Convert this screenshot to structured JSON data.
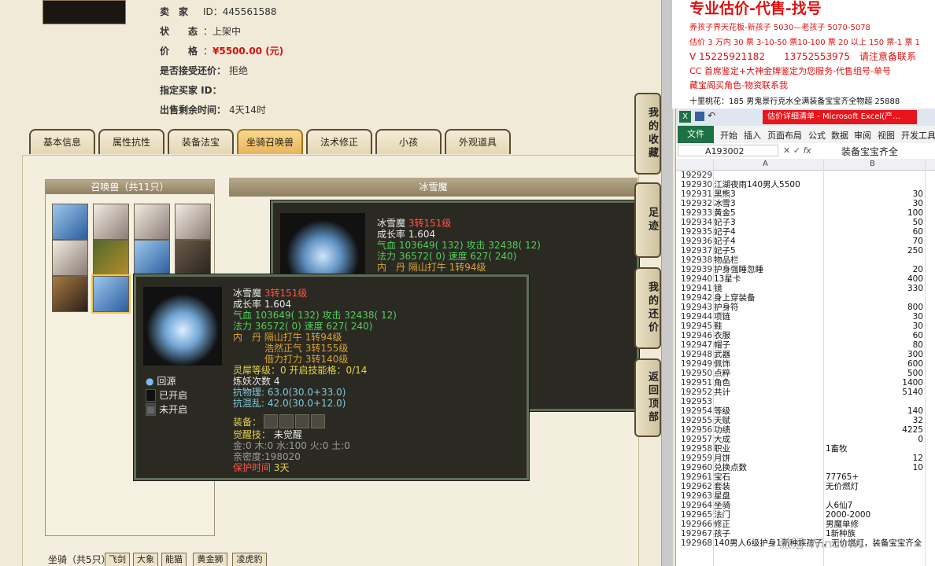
{
  "seller_info": {
    "seller_label": "卖　家",
    "seller_id": "ID：445561588",
    "status_label": "状　　态",
    "status_value": "上架中",
    "price_label": "价　　格",
    "price_value": "¥5500.00 (元)",
    "bargain_label": "是否接受还价：",
    "bargain_value": "拒绝",
    "buyer_label": "指定买家 ID：",
    "buyer_value": "",
    "remaining_label": "出售剩余时间：",
    "remaining_value": "4天14时"
  },
  "tabs": [
    "基本信息",
    "属性抗性",
    "装备法宝",
    "坐骑召唤兽",
    "法术修正",
    "小孩",
    "外观道具"
  ],
  "active_tab": 3,
  "summon": {
    "panel_title": "召唤兽（共11只）",
    "detail_title": "冰雪魔"
  },
  "tooltip_back": {
    "name": "冰雪魔",
    "level": "3转151级",
    "growth": "成长率 1.604",
    "hp": "气血 103649( 132) 攻击 32438( 12)",
    "mp": "法力 36572( 0) 速度 627( 240)",
    "dan": "内　丹 隔山打牛 1转94级",
    "dan2": "浩然正气 3转155级"
  },
  "tooltip_front": {
    "name": "冰雪魔",
    "level": "3转151级",
    "growth": "成长率 1.604",
    "hp": "气血 103649( 132) 攻击 32438( 12)",
    "mp": "法力 36572( 0) 速度 627( 240)",
    "dan1": "内　丹 隔山打牛 1转94级",
    "dan2": "浩然正气 3转155级",
    "dan3": "借力打力 3转140级",
    "lingxi": "灵犀等级：0 开启技能格：0/14",
    "lianyao": "炼妖次数 4",
    "resist1": "抗物理: 63.0(30.0+33.0)",
    "resist2": "抗混乱: 42.0(30.0+12.0)",
    "equip": "装备：",
    "awaken_label": "觉醒技：",
    "awaken_value": "未觉醒",
    "elements": "金:0 木:0 水:100 火:0 土:0",
    "intimacy": "亲密度:198020",
    "protect_label": "保护时间",
    "protect_value": "3天",
    "legend_return": "回源",
    "legend_open": "已开启",
    "legend_closed": "未开启"
  },
  "side_buttons": [
    "我的收藏",
    "足迹",
    "我的还价",
    "返回顶部"
  ],
  "mounts": {
    "label": "坐骑（共5只）",
    "items": [
      "飞剑",
      "大象",
      "能猫",
      "黄金狮",
      "凌虎豹"
    ]
  },
  "promo": {
    "title": "专业估价-代售-找号",
    "line1": "养孩子界天花板-新孩子 5030—老孩子 5070-5078",
    "line2": "估价 3 万内 30 票 3-10-50 票10-100 票 20 以上 150 票-1 票 1",
    "line3": "V 15225921182　　13752553975　请注意备联系",
    "line4": "CC 首席鉴定+大神金牌鉴定为您服务-代售组号-单号",
    "line5": "藏宝阁买角色-物资联系我",
    "line6": "十里桃花：185 男鬼景行克水全满装备宝宝齐全物超 25888"
  },
  "excel": {
    "title": "估价详细清单 - Microsoft Excel(产…",
    "ribbon": [
      "文件",
      "开始",
      "插入",
      "页面布局",
      "公式",
      "数据",
      "审阅",
      "视图",
      "开发工具"
    ],
    "cell_ref": "A193002",
    "formula": "装备宝宝齐全",
    "col_a": "A",
    "col_b": "B",
    "rows": [
      [
        "192929",
        "",
        ""
      ],
      [
        "192930",
        "江湖夜雨140男人5500",
        ""
      ],
      [
        "192931",
        "黑熊3",
        "30"
      ],
      [
        "192932",
        "冰雪3",
        "30"
      ],
      [
        "192933",
        "黄金5",
        "100"
      ],
      [
        "192934",
        "妃子3",
        "50"
      ],
      [
        "192935",
        "妃子4",
        "60"
      ],
      [
        "192936",
        "妃子4",
        "70"
      ],
      [
        "192937",
        "妃子5",
        "250"
      ],
      [
        "192938",
        "物品栏",
        ""
      ],
      [
        "192939",
        "护身强睡忽睡",
        "20"
      ],
      [
        "192940",
        "13星卡",
        "400"
      ],
      [
        "192941",
        "镜",
        "330"
      ],
      [
        "192942",
        "身上穿装备",
        ""
      ],
      [
        "192943",
        "护身符",
        "800"
      ],
      [
        "192944",
        "项链",
        "30"
      ],
      [
        "192945",
        "鞋",
        "30"
      ],
      [
        "192946",
        "衣服",
        "60"
      ],
      [
        "192947",
        "帽子",
        "80"
      ],
      [
        "192948",
        "武器",
        "300"
      ],
      [
        "192949",
        "佩饰",
        "600"
      ],
      [
        "192950",
        "点粹",
        "500"
      ],
      [
        "192951",
        "角色",
        "1400"
      ],
      [
        "192952",
        "共计",
        "5140"
      ],
      [
        "192953",
        "",
        ""
      ],
      [
        "192954",
        "等级",
        "140"
      ],
      [
        "192955",
        "天赋",
        "32"
      ],
      [
        "192956",
        "功绩",
        "4225"
      ],
      [
        "192957",
        "大成",
        "0"
      ],
      [
        "192958",
        "职业",
        "1畜牧"
      ],
      [
        "192959",
        "月饼",
        "12"
      ],
      [
        "192960",
        "兑换点数",
        "10"
      ],
      [
        "192961",
        "宝石",
        "77765+"
      ],
      [
        "192962",
        "套装",
        "无价燃灯"
      ],
      [
        "192963",
        "星盘",
        ""
      ],
      [
        "192964",
        "坐骑",
        "人6仙7"
      ],
      [
        "192965",
        "法门",
        "2000-2000"
      ],
      [
        "192966",
        "修正",
        "男魔单修"
      ],
      [
        "192967",
        "孩子",
        "1新种族"
      ],
      [
        "192968",
        "140男人6级护身1新种族孩子，无价燃灯，装备宝宝齐全",
        ""
      ]
    ],
    "left_aligned_b": [
      "1畜牧",
      "77765+",
      "无价燃灯",
      "人6仙7",
      "2000-2000",
      "男魔单修",
      "1新种族"
    ]
  },
  "watermark": "激活 Windows"
}
